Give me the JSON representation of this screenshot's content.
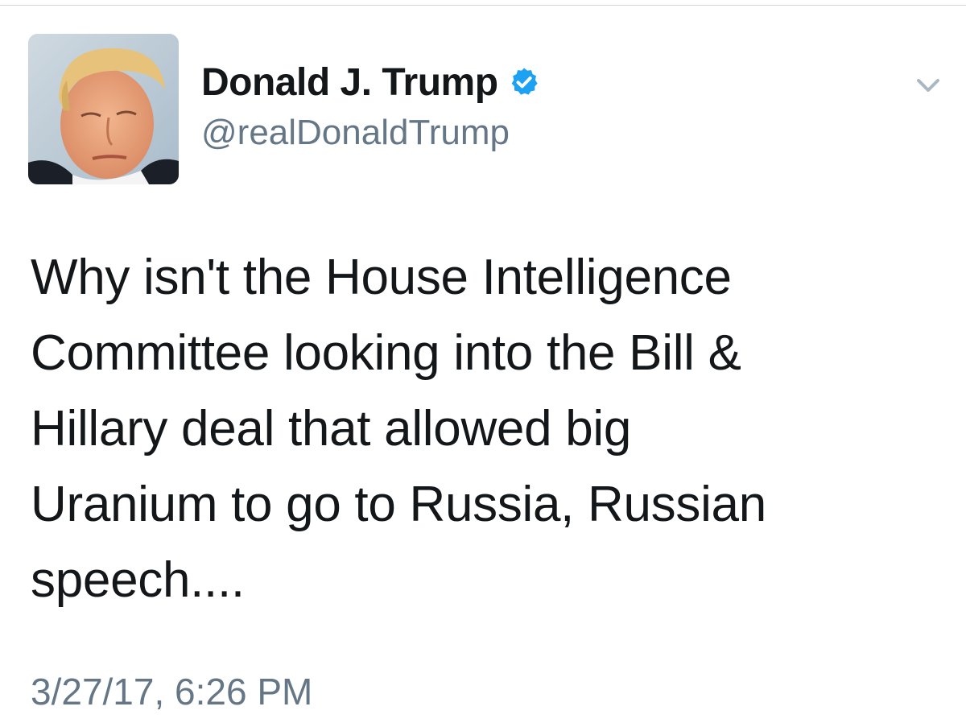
{
  "tweet": {
    "author": {
      "display_name": "Donald J. Trump",
      "handle": "@realDonaldTrump",
      "verified": true,
      "verified_icon": "verified-check-icon",
      "avatar_icon": "profile-photo"
    },
    "text": "Why isn't the House Intelligence\nCommittee looking into the Bill &\nHillary deal that allowed big\nUranium to go to Russia, Russian\nspeech....",
    "timestamp": "3/27/17, 6:26 PM",
    "menu_icon": "chevron-down-icon"
  },
  "colors": {
    "text_primary": "#14171a",
    "text_secondary": "#657786",
    "verified_blue": "#1da1f2",
    "caret_gray": "#aab8c2"
  }
}
